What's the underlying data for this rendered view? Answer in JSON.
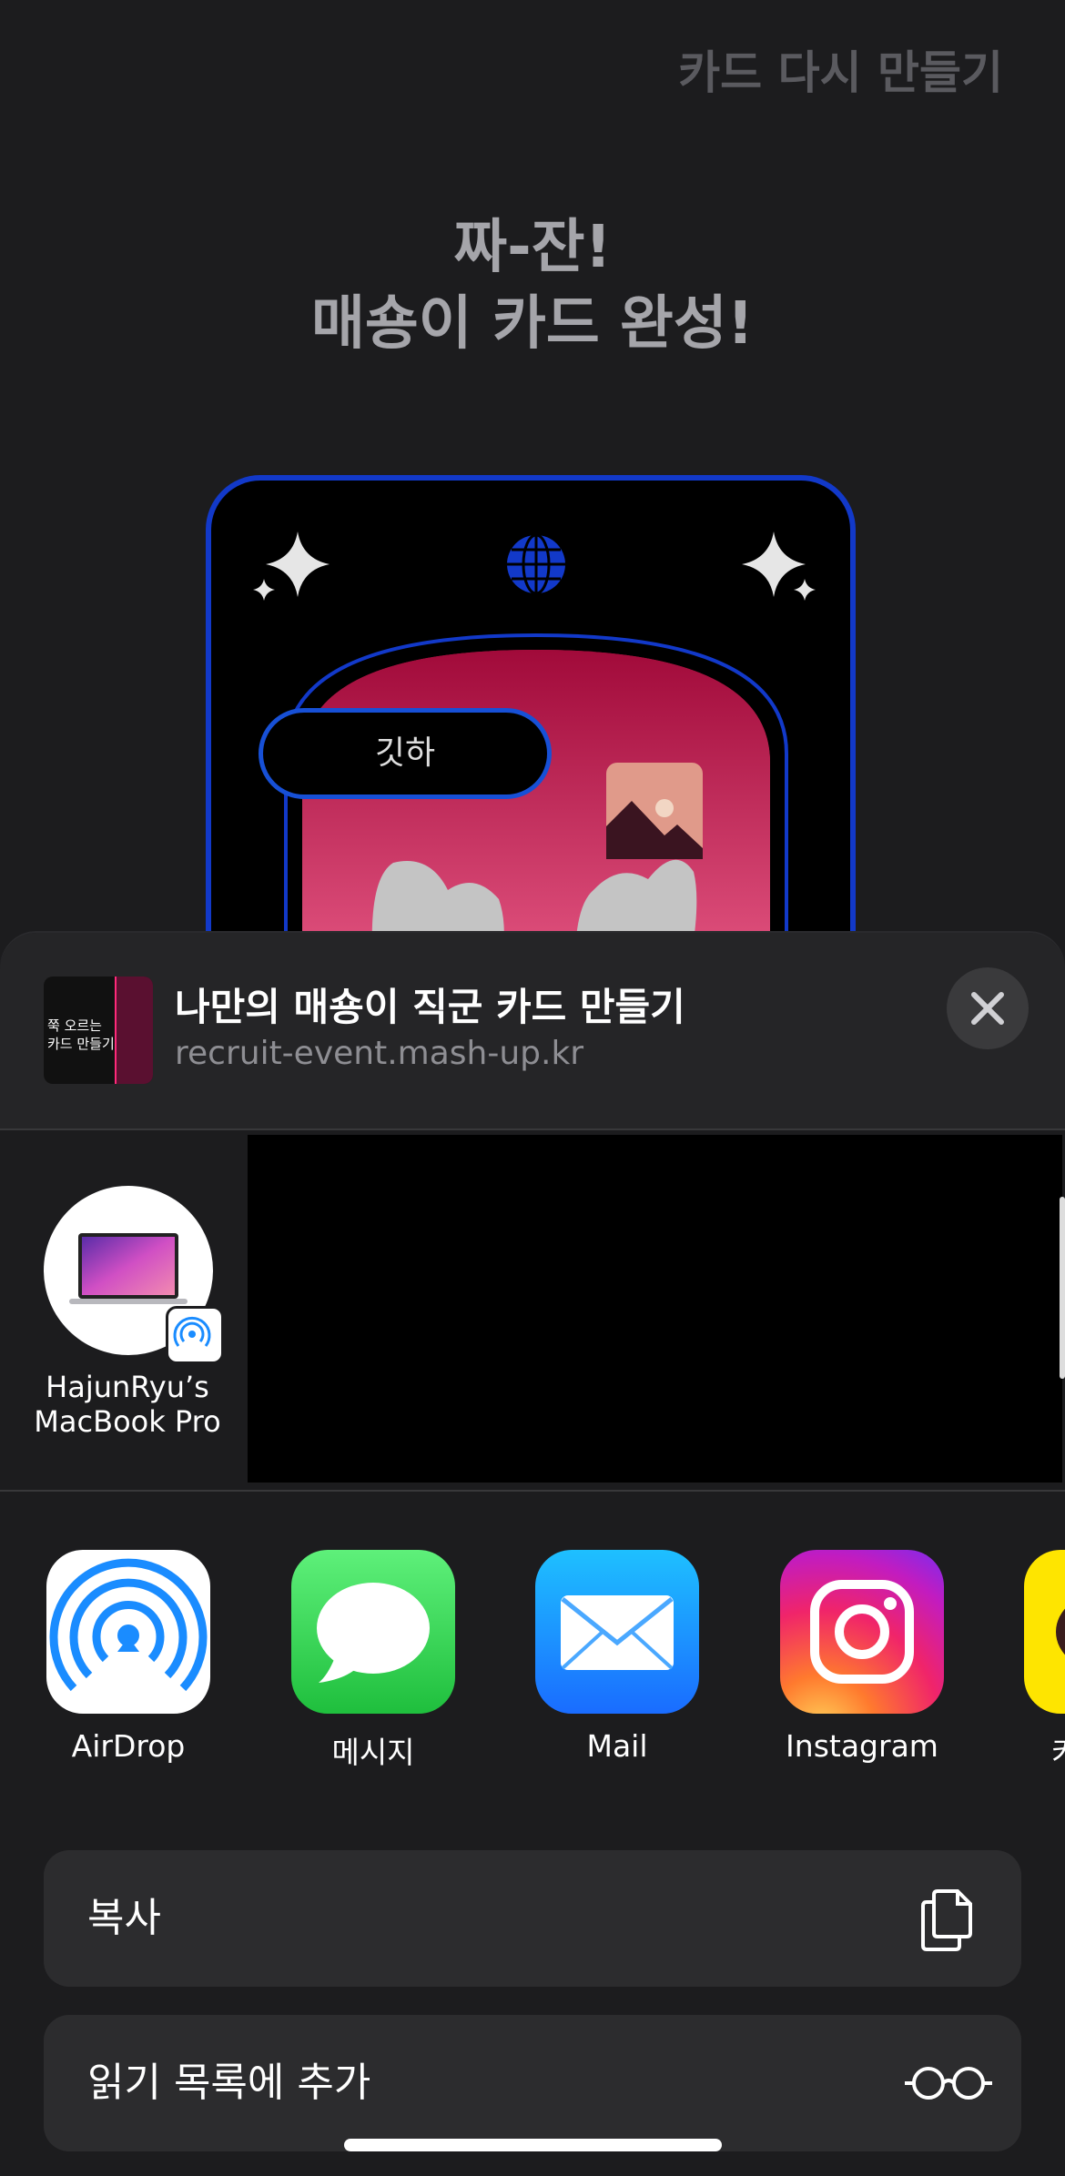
{
  "background_page": {
    "redo_link": "카드 다시 만들기",
    "headline_line1": "짜-잔!",
    "headline_line2": "매숑이 카드 완성!",
    "card": {
      "speech_bubble_text": "깃하"
    }
  },
  "share_sheet": {
    "title": "나만의 매숑이 직군 카드 만들기",
    "url": "recruit-event.mash-up.kr",
    "thumbnail_text_line1": "쭉 오르는",
    "thumbnail_text_line2": "카드 만들기",
    "airdrop_device": {
      "name_line1": "HajunRyu’s",
      "name_line2": "MacBook Pro"
    },
    "apps": [
      {
        "label": "AirDrop",
        "icon": "airdrop-icon"
      },
      {
        "label": "메시지",
        "icon": "messages-icon"
      },
      {
        "label": "Mail",
        "icon": "mail-icon"
      },
      {
        "label": "Instagram",
        "icon": "instagram-icon"
      },
      {
        "label": "카",
        "icon": "kakaotalk-icon"
      }
    ],
    "actions": [
      {
        "label": "복사",
        "icon": "copy-icon"
      },
      {
        "label": "읽기 목록에 추가",
        "icon": "glasses-icon"
      }
    ]
  },
  "colors": {
    "sheet_bg": "#1c1c1e",
    "card_border": "#1239c9",
    "card_pink": "#c2184a",
    "messages_green": "#34c759",
    "mail_blue": "#1a8cff",
    "kakao_yellow": "#fee500"
  }
}
